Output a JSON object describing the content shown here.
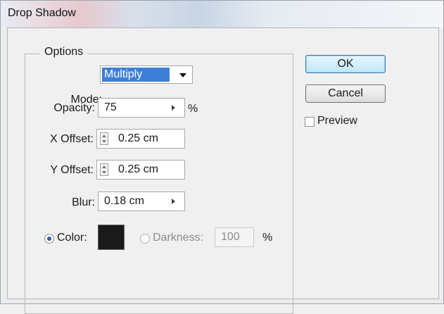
{
  "window": {
    "title": "Drop Shadow"
  },
  "options": {
    "legend": "Options",
    "mode": {
      "label": "Mode:",
      "value": "Multiply"
    },
    "opacity": {
      "label": "Opacity:",
      "value": "75",
      "unit": "%"
    },
    "x_offset": {
      "label": "X Offset:",
      "value": "0.25 cm"
    },
    "y_offset": {
      "label": "Y Offset:",
      "value": "0.25 cm"
    },
    "blur": {
      "label": "Blur:",
      "value": "0.18 cm"
    },
    "color": {
      "label": "Color:",
      "selected": true,
      "swatch": "#1a1a1a"
    },
    "darkness": {
      "label": "Darkness:",
      "value": "100",
      "unit": "%",
      "selected": false
    }
  },
  "buttons": {
    "ok": "OK",
    "cancel": "Cancel"
  },
  "preview": {
    "label": "Preview",
    "checked": false
  }
}
